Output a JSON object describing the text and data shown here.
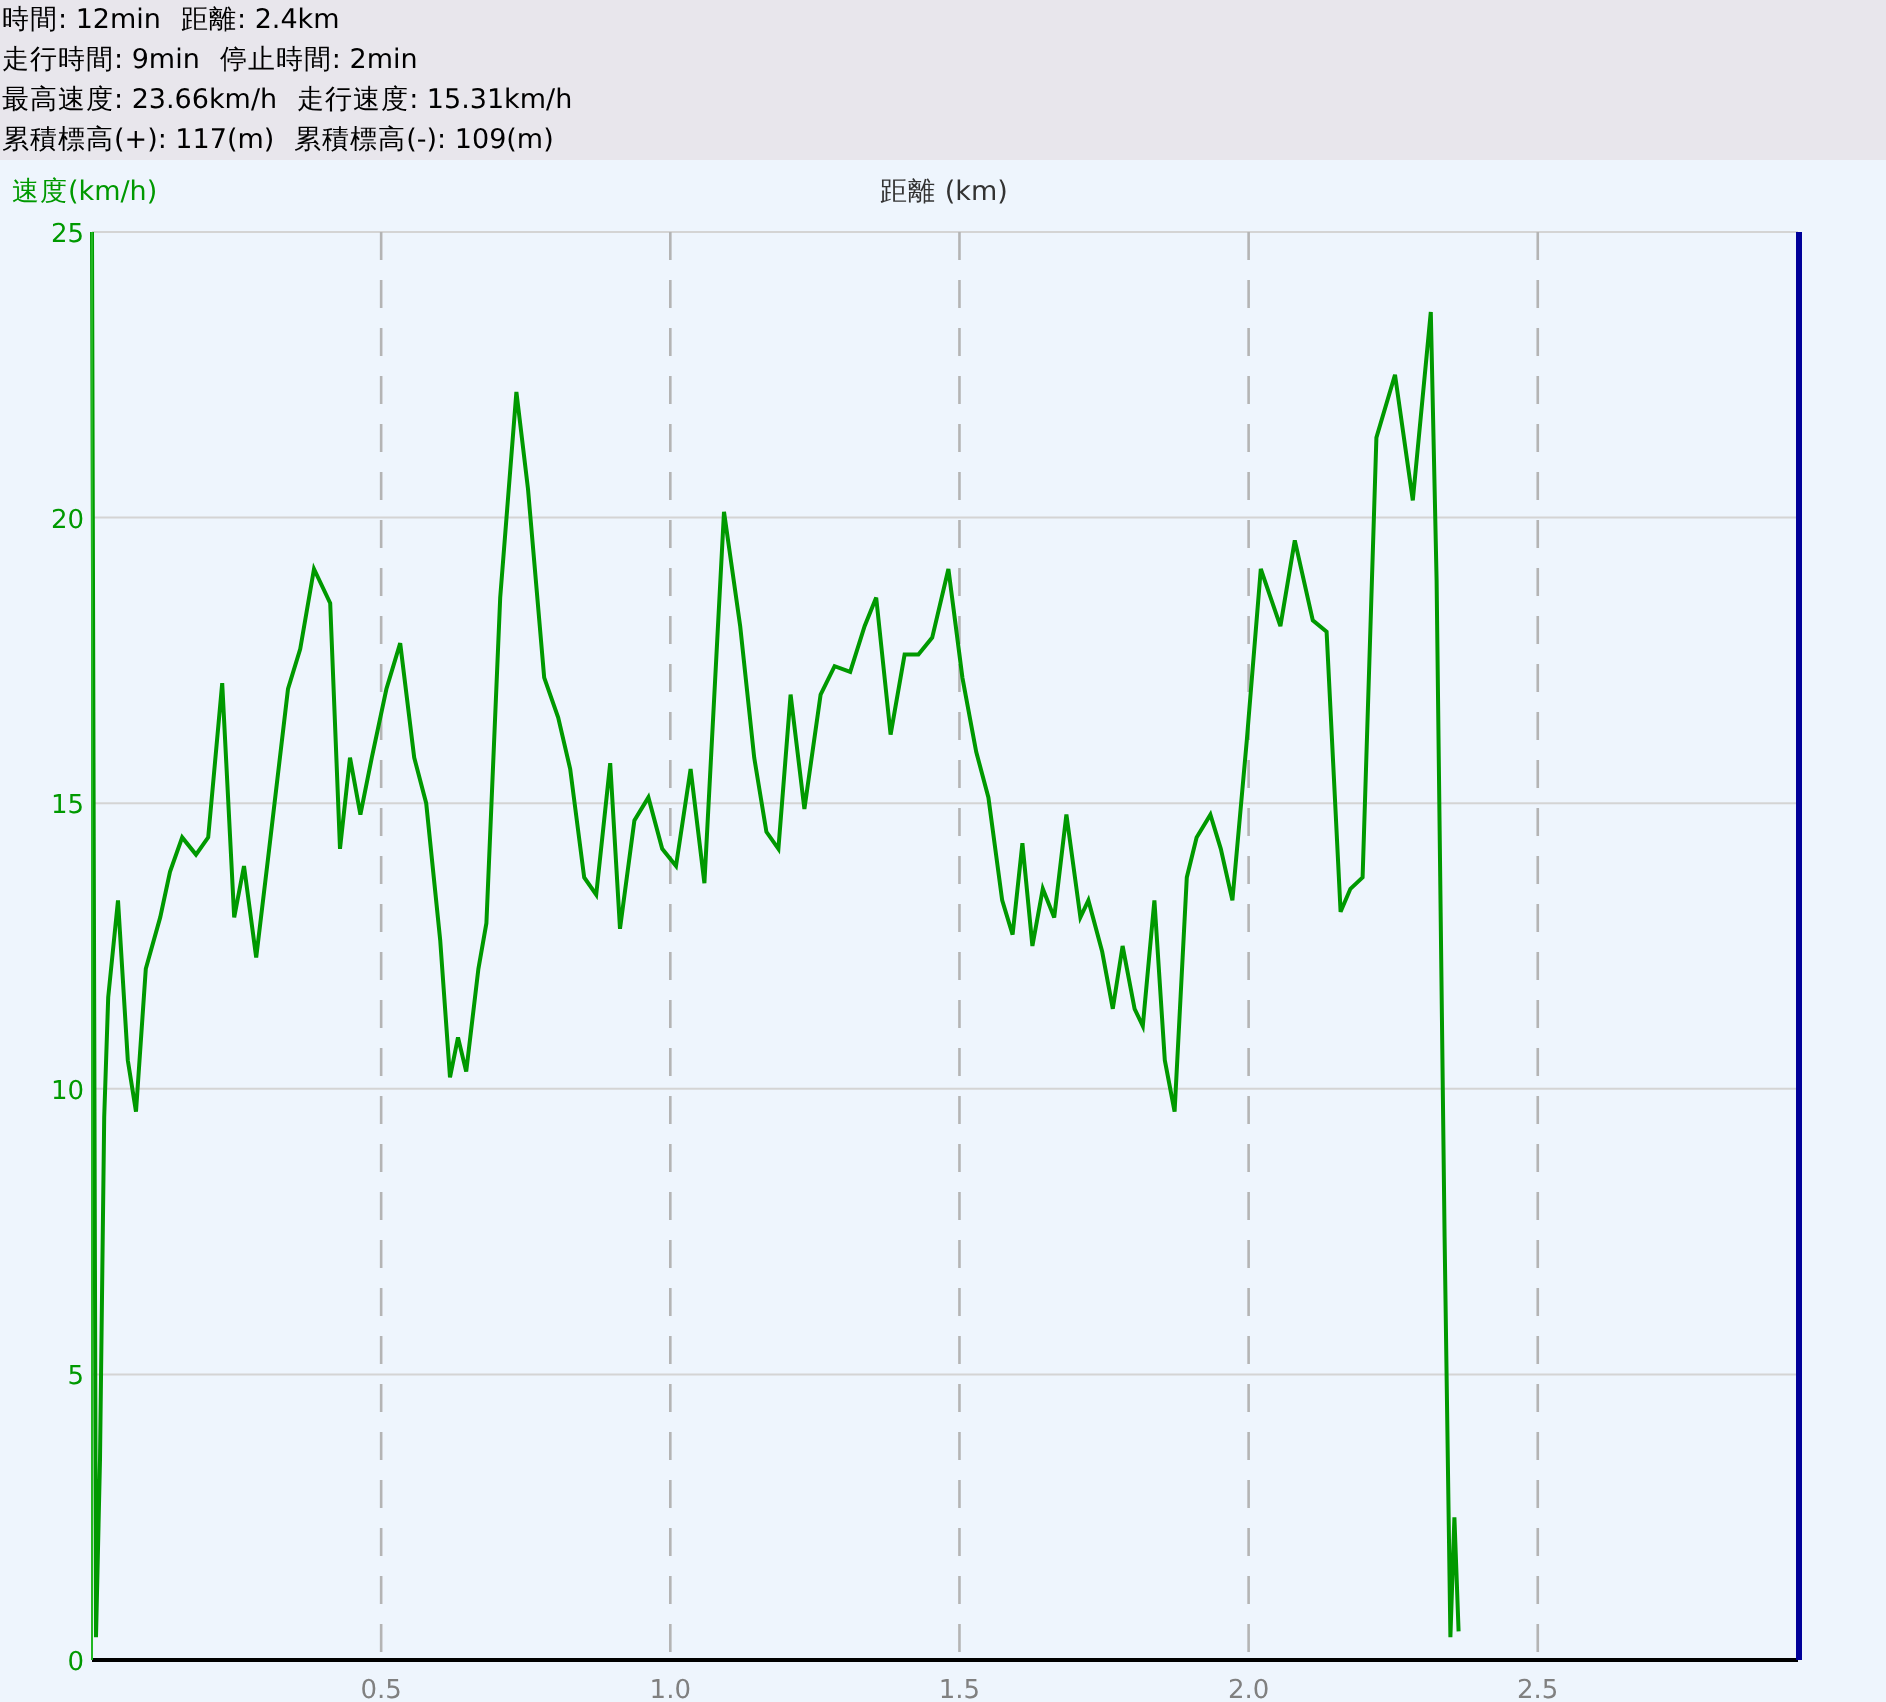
{
  "summary": [
    [
      "時間: 12min",
      "距離: 2.4km"
    ],
    [
      "走行時間: 9min",
      "停止時間: 2min"
    ],
    [
      "最高速度: 23.66km/h",
      "走行速度: 15.31km/h"
    ],
    [
      "累積標高(+): 117(m)",
      "累積標高(-): 109(m)"
    ]
  ],
  "chart": {
    "chart_data": {
      "type": "line",
      "xlabel": "距離 (km)",
      "ylabel": "速度(km/h)",
      "x": [
        0,
        0.007,
        0.014,
        0.021,
        0.028,
        0.045,
        0.062,
        0.076,
        0.093,
        0.118,
        0.135,
        0.156,
        0.18,
        0.201,
        0.225,
        0.246,
        0.263,
        0.284,
        0.304,
        0.339,
        0.36,
        0.384,
        0.412,
        0.429,
        0.446,
        0.464,
        0.484,
        0.509,
        0.533,
        0.557,
        0.578,
        0.602,
        0.619,
        0.633,
        0.647,
        0.668,
        0.682,
        0.706,
        0.734,
        0.754,
        0.782,
        0.806,
        0.827,
        0.851,
        0.872,
        0.896,
        0.913,
        0.938,
        0.962,
        0.986,
        1.01,
        1.035,
        1.059,
        1.093,
        1.121,
        1.145,
        1.166,
        1.187,
        1.208,
        1.232,
        1.26,
        1.284,
        1.311,
        1.336,
        1.356,
        1.381,
        1.405,
        1.429,
        1.453,
        1.481,
        1.505,
        1.529,
        1.55,
        1.574,
        1.592,
        1.609,
        1.626,
        1.644,
        1.664,
        1.685,
        1.709,
        1.723,
        1.747,
        1.765,
        1.782,
        1.803,
        1.817,
        1.837,
        1.855,
        1.872,
        1.893,
        1.91,
        1.934,
        1.952,
        1.972,
        1.997,
        2.021,
        2.055,
        2.08,
        2.111,
        2.135,
        2.159,
        2.176,
        2.197,
        2.221,
        2.253,
        2.284,
        2.315,
        2.325,
        2.339,
        2.349,
        2.356,
        2.363
      ],
      "series": [
        {
          "color": "#009900",
          "values": [
            25,
            0.4,
            3.5,
            9.5,
            11.6,
            13.3,
            10.5,
            9.6,
            12.1,
            13,
            13.8,
            14.4,
            14.1,
            14.4,
            17.1,
            13,
            13.9,
            12.3,
            14,
            17,
            17.7,
            19.1,
            18.5,
            14.2,
            15.8,
            14.8,
            15.8,
            17,
            17.8,
            15.8,
            15,
            12.6,
            10.2,
            10.9,
            10.3,
            12.1,
            12.9,
            18.6,
            22.2,
            20.5,
            17.2,
            16.5,
            15.6,
            13.7,
            13.4,
            15.7,
            12.8,
            14.7,
            15.1,
            14.2,
            13.9,
            15.6,
            13.6,
            20.1,
            18.1,
            15.8,
            14.5,
            14.2,
            16.9,
            14.9,
            16.9,
            17.4,
            17.3,
            18.1,
            18.6,
            16.2,
            17.6,
            17.6,
            17.9,
            19.1,
            17.2,
            15.9,
            15.1,
            13.3,
            12.7,
            14.3,
            12.5,
            13.5,
            13,
            14.8,
            13,
            13.3,
            12.4,
            11.4,
            12.5,
            11.4,
            11.1,
            13.3,
            10.5,
            9.6,
            13.7,
            14.4,
            14.8,
            14.2,
            13.3,
            16.1,
            19.1,
            18.1,
            19.6,
            18.2,
            18,
            13.1,
            13.5,
            13.7,
            21.4,
            22.5,
            20.3,
            23.6,
            18.9,
            7.4,
            0.4,
            2.5,
            0.5
          ]
        }
      ],
      "grid": true,
      "xlim": [
        0,
        2.95
      ],
      "ylim": [
        0,
        25
      ],
      "xticks": [
        {
          "value": 0.5,
          "label": "0.5"
        },
        {
          "value": 1,
          "label": "1.0"
        },
        {
          "value": 1.5,
          "label": "1.5"
        },
        {
          "value": 2,
          "label": "2.0"
        },
        {
          "value": 2.5,
          "label": "2.5"
        }
      ],
      "yticks": [
        0,
        5,
        10,
        15,
        20,
        25
      ]
    }
  }
}
